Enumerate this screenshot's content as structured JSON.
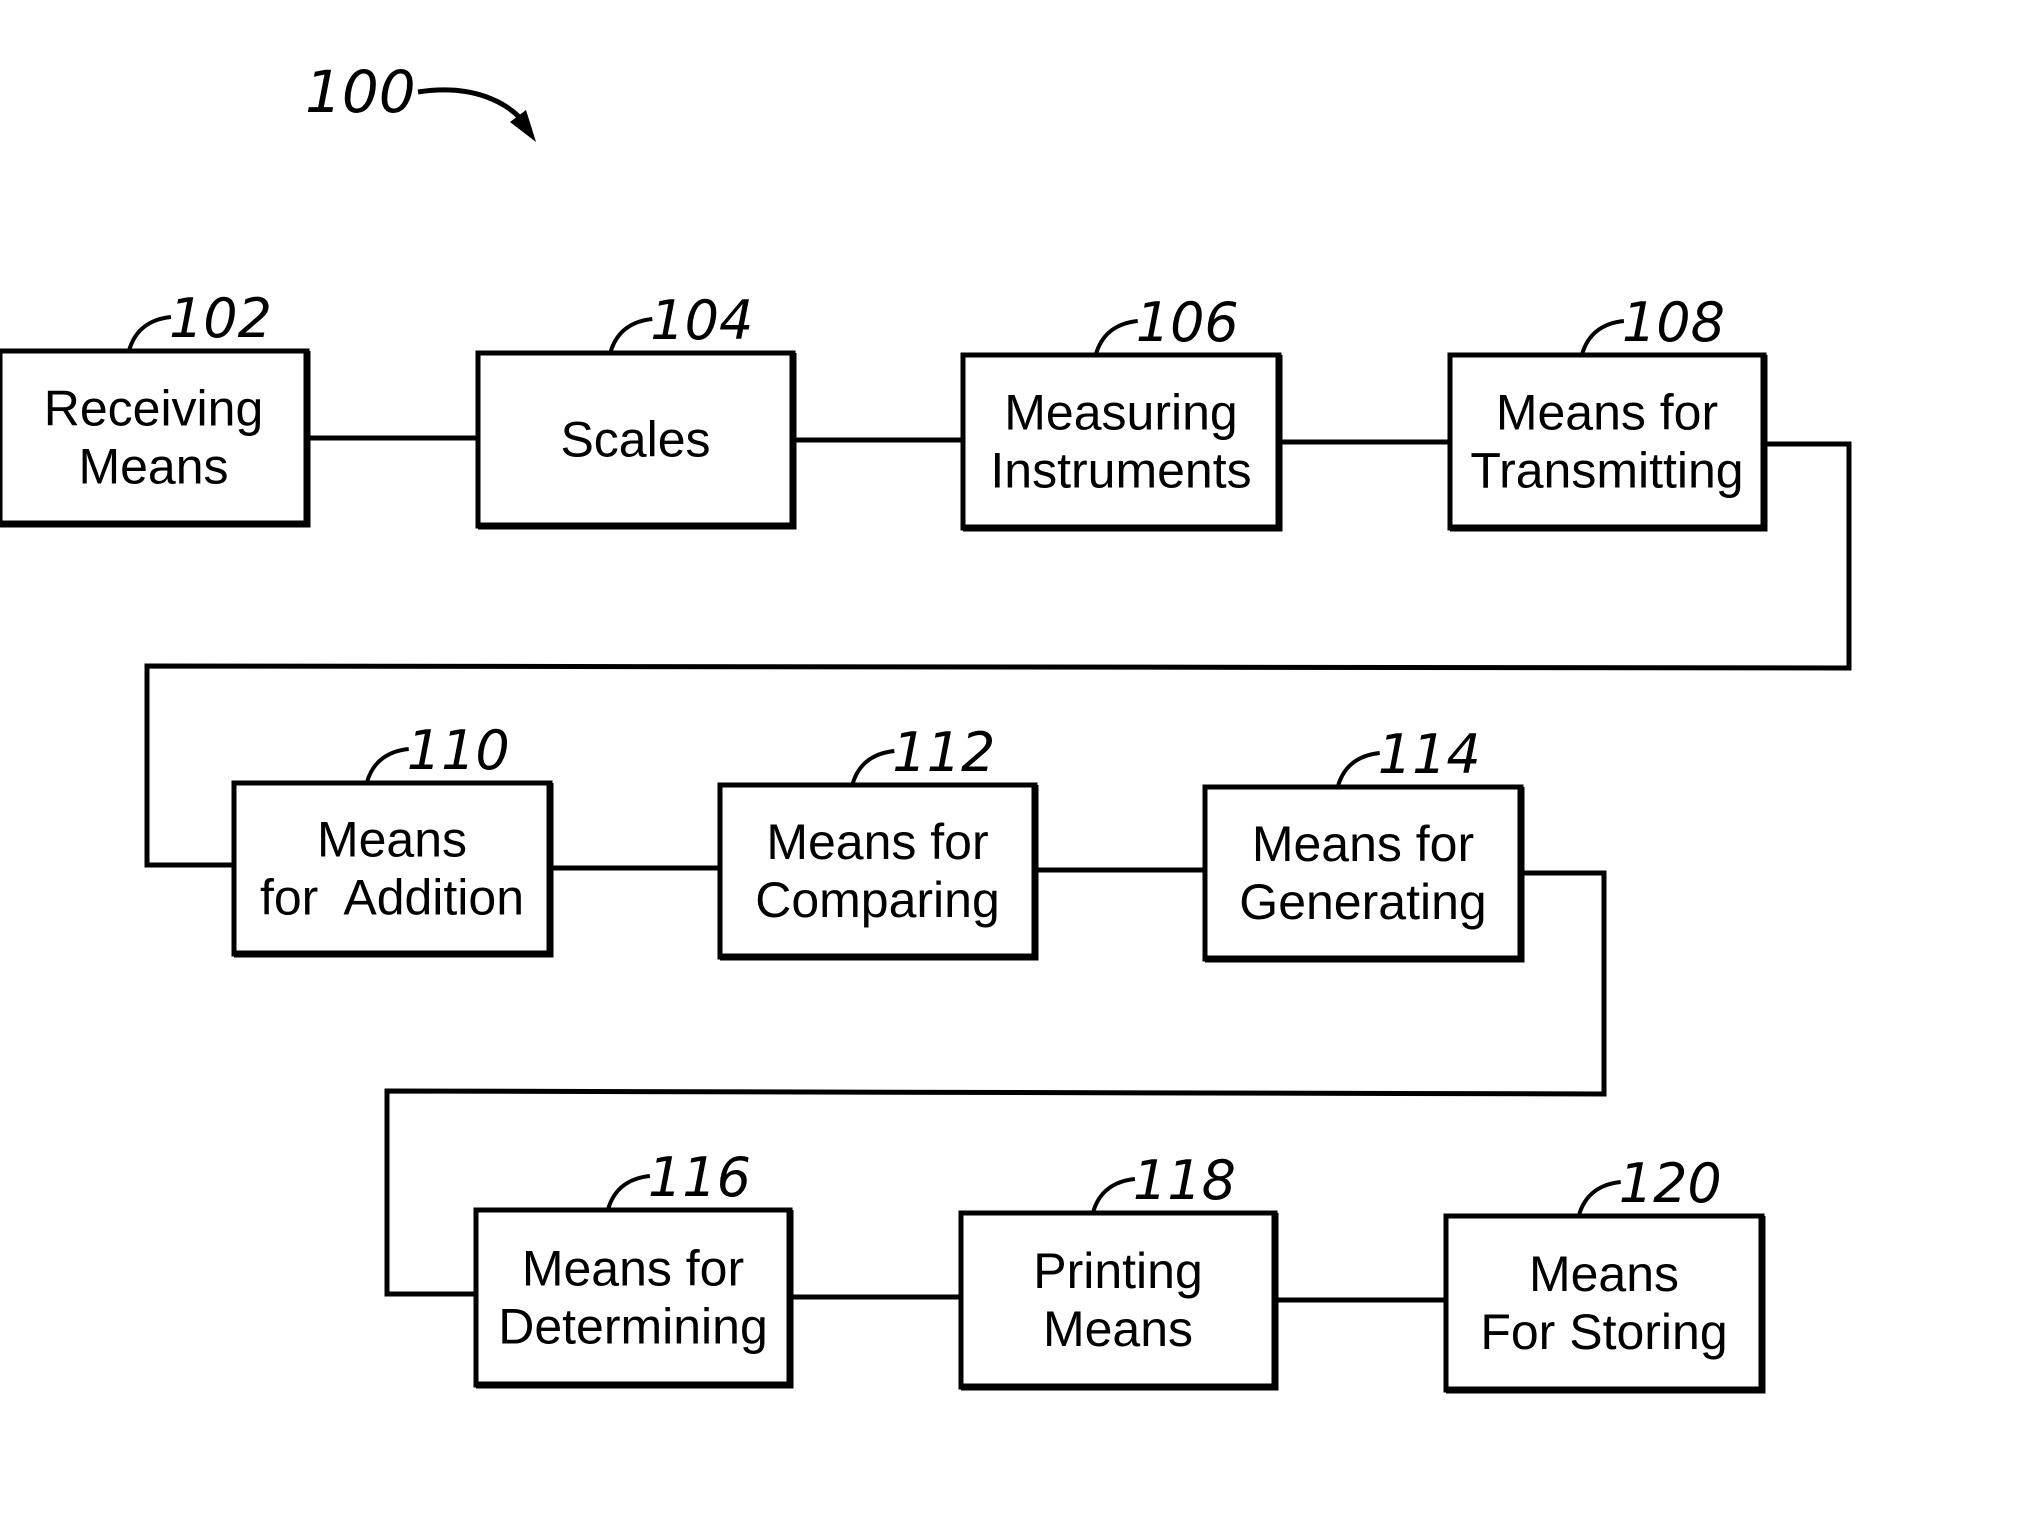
{
  "figure": {
    "ref": "100",
    "blocks": [
      {
        "ref": "102",
        "lines": [
          "Receiving",
          "Means"
        ]
      },
      {
        "ref": "104",
        "lines": [
          "Scales"
        ]
      },
      {
        "ref": "106",
        "lines": [
          "Measuring",
          "Instruments"
        ]
      },
      {
        "ref": "108",
        "lines": [
          "Means for",
          "Transmitting"
        ]
      },
      {
        "ref": "110",
        "lines": [
          "Means",
          "for  Addition"
        ]
      },
      {
        "ref": "112",
        "lines": [
          "Means for",
          "Comparing"
        ]
      },
      {
        "ref": "114",
        "lines": [
          "Means for",
          "Generating"
        ]
      },
      {
        "ref": "116",
        "lines": [
          "Means for",
          "Determining"
        ]
      },
      {
        "ref": "118",
        "lines": [
          "Printing",
          "Means"
        ]
      },
      {
        "ref": "120",
        "lines": [
          "Means",
          "For Storing"
        ]
      }
    ],
    "stroke_color": "#000000",
    "background_color": "#ffffff"
  }
}
